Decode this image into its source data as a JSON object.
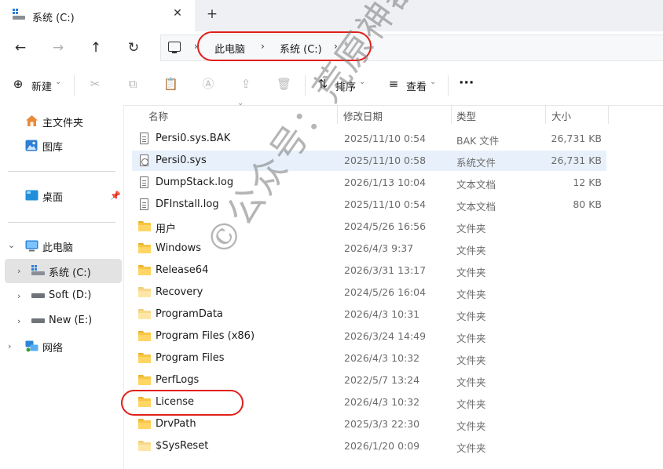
{
  "window": {
    "tab_title": "系统 (C:)",
    "close_glyph": "✕",
    "new_tab_glyph": "+"
  },
  "nav": {
    "back_glyph": "←",
    "forward_glyph": "→",
    "up_glyph": "↑",
    "refresh_glyph": "↻"
  },
  "breadcrumb": {
    "sep": "›",
    "items": [
      "此电脑",
      "系统 (C:)"
    ]
  },
  "toolbar": {
    "new_label": "新建",
    "new_glyph": "⊕",
    "sort_label": "排序",
    "view_label": "查看",
    "more_glyph": "···",
    "cut_glyph": "✂",
    "copy_glyph": "⧉",
    "paste_glyph": "📋",
    "rename_glyph": "Ⓐ",
    "share_glyph": "⇪",
    "delete_glyph": "🗑",
    "sort_glyph": "⇅",
    "view_glyph": "≡",
    "dropdown_glyph": "⌄"
  },
  "sidebar": {
    "home": "主文件夹",
    "gallery": "图库",
    "desktop": "桌面",
    "this_pc": "此电脑",
    "drive_c": "系统 (C:)",
    "drive_d": "Soft (D:)",
    "drive_e": "New (E:)",
    "network": "网络",
    "pin_glyph": "📌",
    "chev_right": "›",
    "chev_down": "⌄"
  },
  "columns": {
    "name": "名称",
    "date": "修改日期",
    "type": "类型",
    "size": "大小",
    "sort_indicator": "⌄"
  },
  "files": [
    {
      "name": "Persi0.sys.BAK",
      "date": "2025/11/10 0:54",
      "type": "BAK 文件",
      "size": "26,731 KB",
      "icon": "document-icon"
    },
    {
      "name": "Persi0.sys",
      "date": "2025/11/10 0:58",
      "type": "系统文件",
      "size": "26,731 KB",
      "icon": "system-file-icon"
    },
    {
      "name": "DumpStack.log",
      "date": "2026/1/13 10:04",
      "type": "文本文档",
      "size": "12 KB",
      "icon": "document-icon"
    },
    {
      "name": "DFInstall.log",
      "date": "2025/11/10 0:54",
      "type": "文本文档",
      "size": "80 KB",
      "icon": "document-icon"
    },
    {
      "name": "用户",
      "date": "2024/5/26 16:56",
      "type": "文件夹",
      "size": "",
      "icon": "folder-icon"
    },
    {
      "name": "Windows",
      "date": "2026/4/3 9:37",
      "type": "文件夹",
      "size": "",
      "icon": "folder-icon"
    },
    {
      "name": "Release64",
      "date": "2026/3/31 13:17",
      "type": "文件夹",
      "size": "",
      "icon": "folder-icon"
    },
    {
      "name": "Recovery",
      "date": "2024/5/26 16:04",
      "type": "文件夹",
      "size": "",
      "icon": "folder-pale-icon"
    },
    {
      "name": "ProgramData",
      "date": "2026/4/3 10:31",
      "type": "文件夹",
      "size": "",
      "icon": "folder-pale-icon"
    },
    {
      "name": "Program Files (x86)",
      "date": "2026/3/24 14:49",
      "type": "文件夹",
      "size": "",
      "icon": "folder-icon"
    },
    {
      "name": "Program Files",
      "date": "2026/4/3 10:32",
      "type": "文件夹",
      "size": "",
      "icon": "folder-icon"
    },
    {
      "name": "PerfLogs",
      "date": "2022/5/7 13:24",
      "type": "文件夹",
      "size": "",
      "icon": "folder-icon"
    },
    {
      "name": "License",
      "date": "2026/4/3 10:32",
      "type": "文件夹",
      "size": "",
      "icon": "folder-icon"
    },
    {
      "name": "DrvPath",
      "date": "2025/3/3 22:30",
      "type": "文件夹",
      "size": "",
      "icon": "folder-icon"
    },
    {
      "name": "$SysReset",
      "date": "2026/1/20 0:09",
      "type": "文件夹",
      "size": "",
      "icon": "folder-pale-icon"
    }
  ],
  "watermark": "©公众号：荒原神器",
  "colors": {
    "highlight": "#e0201a",
    "selected_row": "#e8f1fb",
    "folder": "#f6c644"
  }
}
